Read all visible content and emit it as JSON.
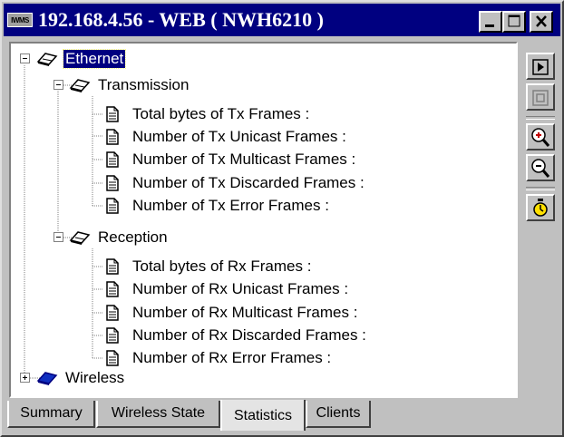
{
  "window": {
    "app_icon_text": "IWMS",
    "title": "192.168.4.56 - WEB ( NWH6210 )",
    "controls": {
      "minimize": "minimize-icon",
      "maximize": "maximize-icon",
      "close": "close-icon"
    }
  },
  "tree": {
    "root": {
      "label": "Ethernet",
      "selected": true,
      "expanded": true,
      "icon": "network-icon"
    },
    "transmission": {
      "label": "Transmission",
      "expanded": true,
      "items": [
        {
          "label": "Total bytes of Tx Frames :"
        },
        {
          "label": "Number of Tx Unicast Frames :"
        },
        {
          "label": "Number of Tx Multicast Frames :"
        },
        {
          "label": "Number of Tx Discarded Frames :"
        },
        {
          "label": "Number of Tx Error Frames :"
        }
      ]
    },
    "reception": {
      "label": "Reception",
      "expanded": true,
      "items": [
        {
          "label": "Total bytes of Rx Frames :"
        },
        {
          "label": "Number of Rx Unicast Frames :"
        },
        {
          "label": "Number of Rx Multicast Frames :"
        },
        {
          "label": "Number of Rx Discarded Frames :"
        },
        {
          "label": "Number of Rx Error Frames :"
        }
      ]
    },
    "wireless": {
      "label": "Wireless",
      "expanded": false,
      "icon": "wireless-icon"
    }
  },
  "toolbar": {
    "buttons": [
      "play-icon",
      "stop-icon",
      "zoom-in-icon",
      "zoom-out-icon",
      "stopwatch-icon"
    ]
  },
  "tabs": [
    {
      "label": "Summary",
      "active": false
    },
    {
      "label": "Wireless State",
      "active": false
    },
    {
      "label": "Statistics",
      "active": true
    },
    {
      "label": "Clients",
      "active": false
    }
  ],
  "colors": {
    "titlebar": "#000080",
    "selection": "#000080",
    "face": "#c0c0c0",
    "wireless_icon": "#1030c0"
  }
}
